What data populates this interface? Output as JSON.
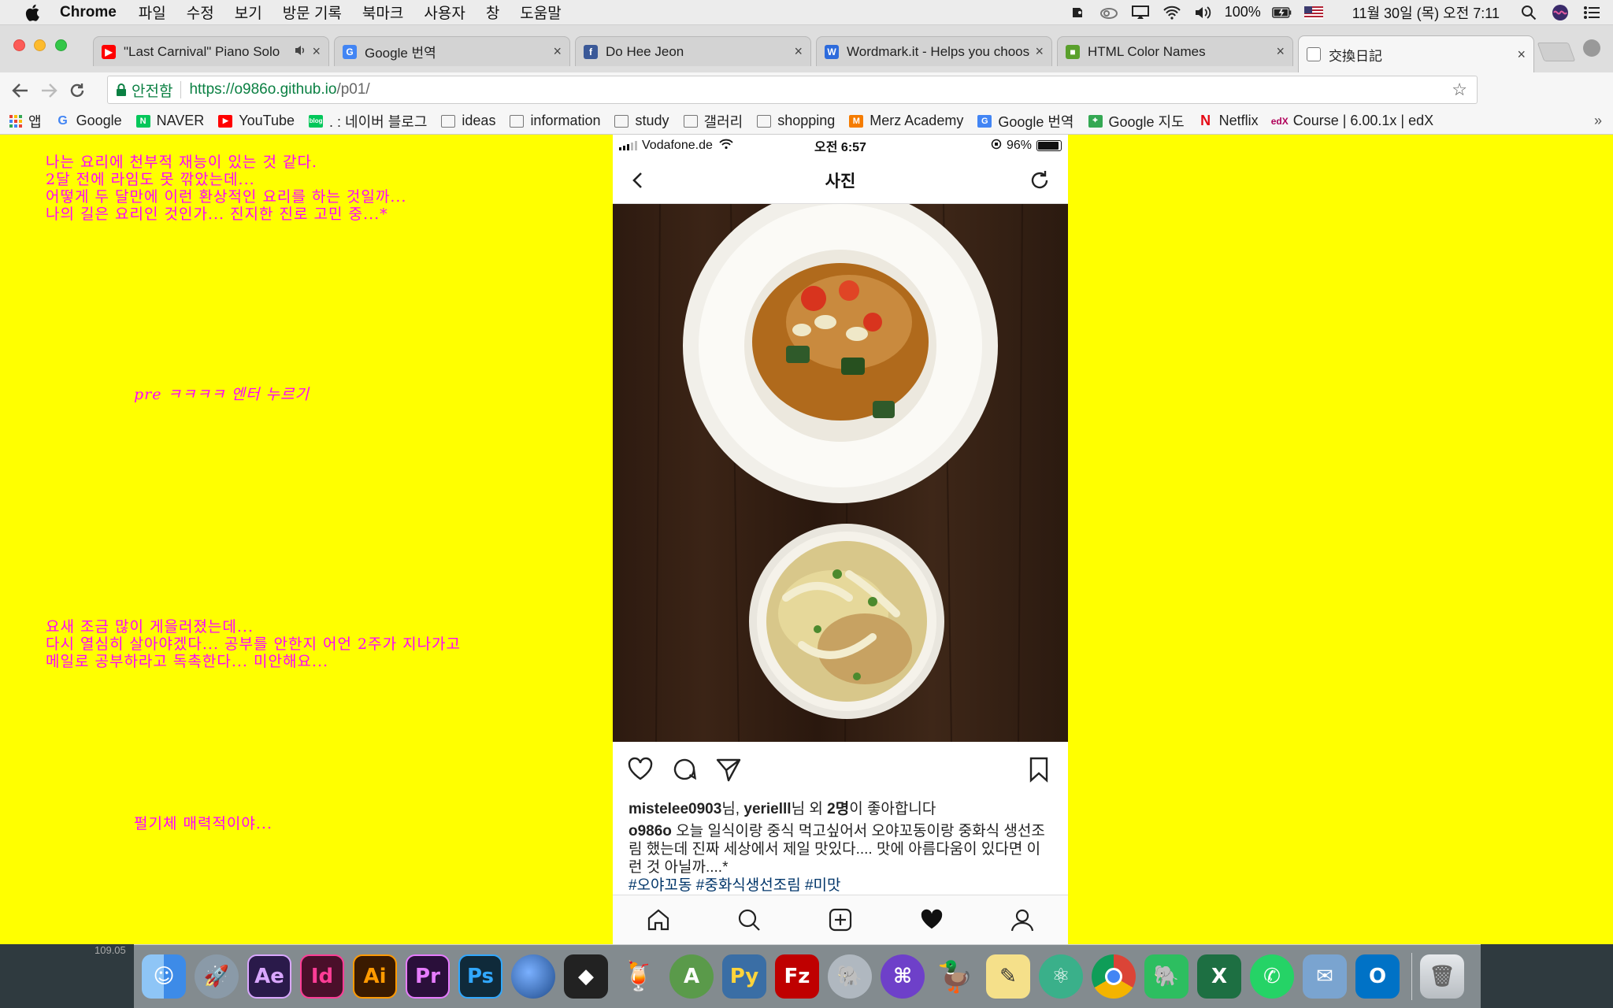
{
  "menubar": {
    "items": [
      "Chrome",
      "파일",
      "수정",
      "보기",
      "방문 기록",
      "북마크",
      "사용자",
      "창",
      "도움말"
    ],
    "battery": "100%",
    "datetime": "11월 30일 (목) 오전 7:11"
  },
  "tabs": [
    {
      "title": "\"Last Carnival\" Piano Solo",
      "favicon": "youtube-icon",
      "color": "#ff0000",
      "audio": true
    },
    {
      "title": "Google 번역",
      "favicon": "google-translate-icon",
      "color": "#4285f4"
    },
    {
      "title": "Do Hee Jeon",
      "favicon": "facebook-icon",
      "color": "#3b5998"
    },
    {
      "title": "Wordmark.it - Helps you choose",
      "favicon": "wordmark-icon",
      "color": "#2d6bdc"
    },
    {
      "title": "HTML Color Names",
      "favicon": "color-names-icon",
      "color": "#5aa02c"
    },
    {
      "title": "交換日記",
      "favicon": "document-icon",
      "color": "#888888",
      "active": true
    }
  ],
  "omnibox": {
    "secure_label": "안전함",
    "url_host": "https://o986o.github.io",
    "url_path": "/p01/"
  },
  "bookmarks": [
    {
      "label": "앱",
      "icon": "apps-grid-icon",
      "color": "#e94235"
    },
    {
      "label": "Google",
      "icon": "google-icon",
      "color": "#4285f4"
    },
    {
      "label": "NAVER",
      "icon": "naver-icon",
      "color": "#03c75a"
    },
    {
      "label": "YouTube",
      "icon": "youtube-icon",
      "color": "#ff0000"
    },
    {
      "label": ". : 네이버 블로그",
      "icon": "blog-icon",
      "color": "#03c75a"
    },
    {
      "label": "ideas",
      "icon": "folder-icon",
      "color": ""
    },
    {
      "label": "information",
      "icon": "folder-icon",
      "color": ""
    },
    {
      "label": "study",
      "icon": "folder-icon",
      "color": ""
    },
    {
      "label": "갤러리",
      "icon": "folder-icon",
      "color": ""
    },
    {
      "label": "shopping",
      "icon": "folder-icon",
      "color": ""
    },
    {
      "label": "Merz Academy",
      "icon": "merz-icon",
      "color": "#f57c00"
    },
    {
      "label": "Google 번역",
      "icon": "google-translate-icon",
      "color": "#4285f4"
    },
    {
      "label": "Google 지도",
      "icon": "google-maps-icon",
      "color": "#34a853"
    },
    {
      "label": "Netflix",
      "icon": "netflix-icon",
      "color": "#e50914"
    },
    {
      "label": "Course | 6.00.1x | edX",
      "icon": "edx-icon",
      "color": "#b0005a"
    }
  ],
  "page": {
    "background": "#ffff00",
    "text_color": "#ff00ff",
    "note1": "나는 요리에 천부적 재능이 있는 것 같다.\n2달 전에 라임도 못 깎았는데...\n어떻게 두 달만에 이런 환상적인 요리를 하는 것일까...\n나의 길은 요리인 것인가... 진지한 진로 고민 중...*",
    "note2": "pre ㅋㅋㅋㅋ 엔터 누르기",
    "note3": "요새 조금 많이 게을러졌는데...\n다시 열심히 살아야겠다... 공부를 안한지 어언 2주가 지나가고\n메일로 공부하라고 독촉한다... 미안해요...",
    "note4": "펄기체 매력적이야..."
  },
  "phone": {
    "carrier": "Vodafone.de",
    "time": "오전 6:57",
    "battery": "96%",
    "header_title": "사진",
    "likes_users": "mistelee0903",
    "likes_sep1": "님, ",
    "likes_user2": "yerielll",
    "likes_sep2": "님 외 ",
    "likes_count": "2명",
    "likes_suffix": "이 좋아합니다",
    "caption_user": "o986o",
    "caption_text": " 오늘 일식이랑 중식 먹고싶어서 오야꼬동이랑 중화식 생선조림 했는데 진짜 세상에서 제일 맛있다.... 맛에 아름다움이 있다면 이런 것 아닐까....*",
    "caption_tags": "#오야꼬동 #중화식생선조림 #미맛"
  },
  "desktop": {
    "desk_text": "109.05"
  },
  "dock": [
    {
      "name": "finder-icon",
      "label": "",
      "color": "#3d8be8"
    },
    {
      "name": "launchpad-icon",
      "label": "",
      "color": "#8a9aa8"
    },
    {
      "name": "after-effects-icon",
      "label": "Ae",
      "color": "#2a1a4a"
    },
    {
      "name": "indesign-icon",
      "label": "Id",
      "color": "#4a0f2a"
    },
    {
      "name": "illustrator-icon",
      "label": "Ai",
      "color": "#3a1a00"
    },
    {
      "name": "premiere-icon",
      "label": "Pr",
      "color": "#2a0f3a"
    },
    {
      "name": "photoshop-icon",
      "label": "Ps",
      "color": "#0f2a3a"
    },
    {
      "name": "cinema4d-icon",
      "label": "",
      "color": "#1e4a8a"
    },
    {
      "name": "unity-icon",
      "label": "",
      "color": "#222222"
    },
    {
      "name": "drink-icon",
      "label": "",
      "color": "#d98c3a"
    },
    {
      "name": "android-studio-icon",
      "label": "",
      "color": "#5a9a4a"
    },
    {
      "name": "python-icon",
      "label": "",
      "color": "#3a6ea5"
    },
    {
      "name": "filezilla-icon",
      "label": "Fz",
      "color": "#bf0000"
    },
    {
      "name": "sequel-pro-icon",
      "label": "",
      "color": "#b0b8c0"
    },
    {
      "name": "github-desktop-icon",
      "label": "",
      "color": "#6e40c9"
    },
    {
      "name": "cyberduck-icon",
      "label": "",
      "color": "#e8c020"
    },
    {
      "name": "notes-icon",
      "label": "",
      "color": "#f5e08a"
    },
    {
      "name": "atom-icon",
      "label": "",
      "color": "#3ab08a"
    },
    {
      "name": "chrome-icon",
      "label": "",
      "color": "#e8e8e8"
    },
    {
      "name": "evernote-icon",
      "label": "",
      "color": "#2dbe60"
    },
    {
      "name": "excel-icon",
      "label": "X",
      "color": "#1d6f42"
    },
    {
      "name": "whatsapp-icon",
      "label": "",
      "color": "#25d366"
    },
    {
      "name": "mail-icon",
      "label": "",
      "color": "#7aa4d0"
    },
    {
      "name": "outlook-icon",
      "label": "O",
      "color": "#0072c6"
    },
    {
      "name": "trash-icon",
      "label": "",
      "color": "#c8ccd0"
    }
  ]
}
